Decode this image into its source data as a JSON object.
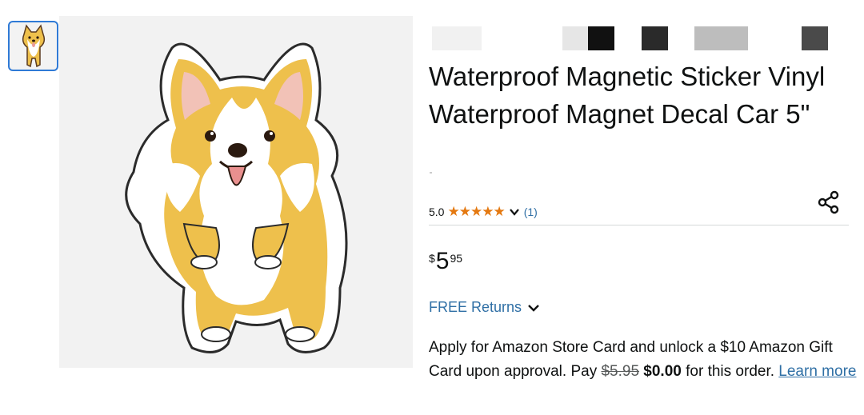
{
  "gallery": {
    "thumbnail_icon": "corgi-sticker-thumbnail",
    "main_image_icon": "corgi-sticker-image"
  },
  "product": {
    "title": "Waterproof Magnetic Sticker Vinyl Waterproof Magnet Decal Car 5\""
  },
  "rating": {
    "value": "5.0",
    "stars": 5,
    "count": "(1)",
    "star_color": "#e47911"
  },
  "share": {
    "icon": "share-icon"
  },
  "price": {
    "symbol": "$",
    "whole": "5",
    "fraction": "95"
  },
  "returns": {
    "label": "FREE Returns",
    "icon": "chevron-down-icon"
  },
  "promo": {
    "text_before": "Apply for Amazon Store Card and unlock a $10 Amazon Gift Card upon approval. Pay ",
    "old_price": "$5.95",
    "new_price": "$0.00",
    "text_after": " for this order. ",
    "learn_more": "Learn more"
  },
  "colors": {
    "link": "#2f6fa5",
    "accent_thumb_border": "#2f7ad6",
    "corgi_yellow": "#eec04c"
  }
}
